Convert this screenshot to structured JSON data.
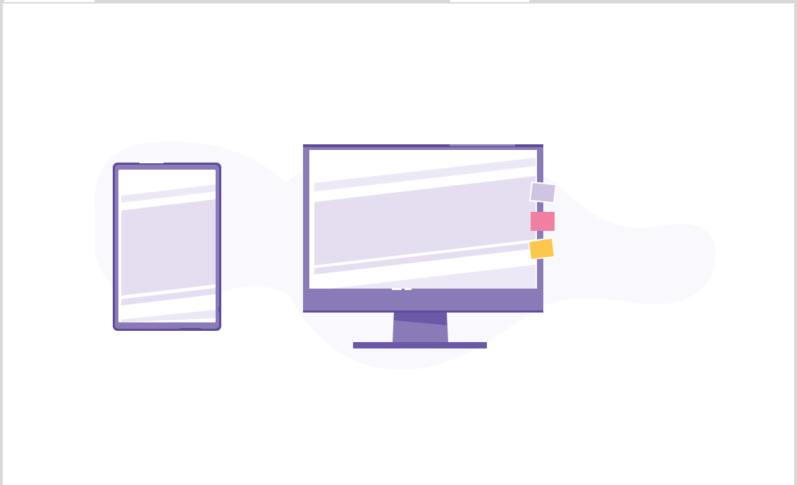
{
  "illustration": {
    "name": "devices-illustration",
    "icons": [
      "tablet-icon",
      "monitor-icon",
      "sticky-note-icon"
    ]
  },
  "colors": {
    "device_frame": "#8b7ab8",
    "device_outline": "#5e4a9a",
    "screen": "#ffffff",
    "screen_band": "#e5def0",
    "screen_band_light": "#ede8f5",
    "blob": "#f9f8fc",
    "sticky_lavender": "#cfc4e3",
    "sticky_pink": "#f07fa2",
    "sticky_yellow": "#fdc64d",
    "border": "#d9d9d9"
  }
}
